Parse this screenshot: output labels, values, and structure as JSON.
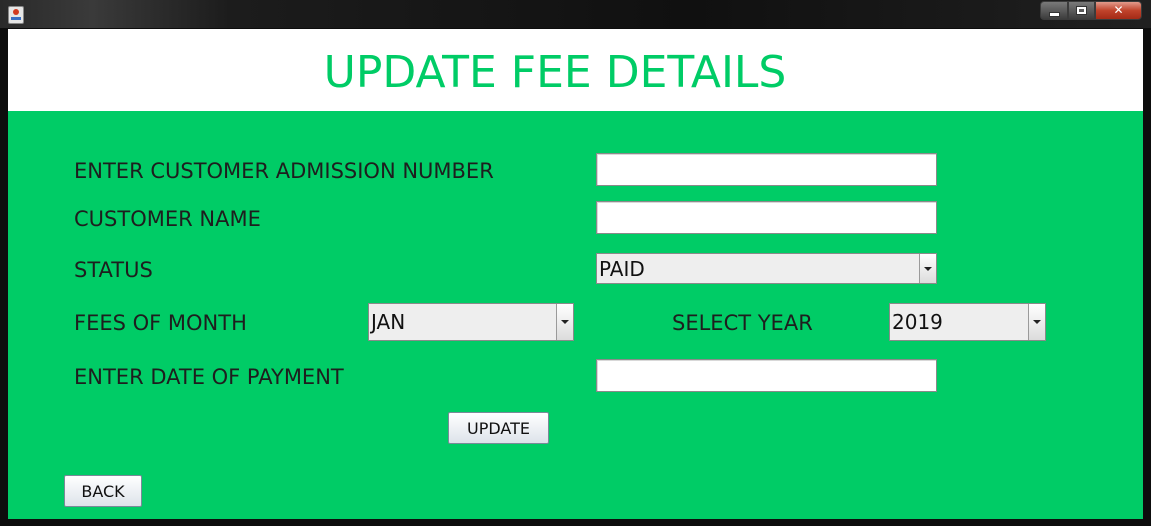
{
  "window": {
    "close_glyph": "✕"
  },
  "header": {
    "title": "UPDATE FEE DETAILS"
  },
  "form": {
    "admission_label": "ENTER CUSTOMER ADMISSION NUMBER",
    "admission_value": "",
    "customer_name_label": "CUSTOMER NAME",
    "customer_name_value": "",
    "status_label": "STATUS",
    "status_value": "PAID",
    "month_label": "FEES OF MONTH",
    "month_value": "JAN",
    "year_label": "SELECT YEAR",
    "year_value": "2019",
    "payment_date_label": "ENTER DATE OF PAYMENT",
    "payment_date_value": ""
  },
  "buttons": {
    "update": "UPDATE",
    "back": "BACK"
  },
  "colors": {
    "accent": "#00cc66",
    "header_bg": "#ffffff",
    "label_text": "#1e1e1e"
  }
}
